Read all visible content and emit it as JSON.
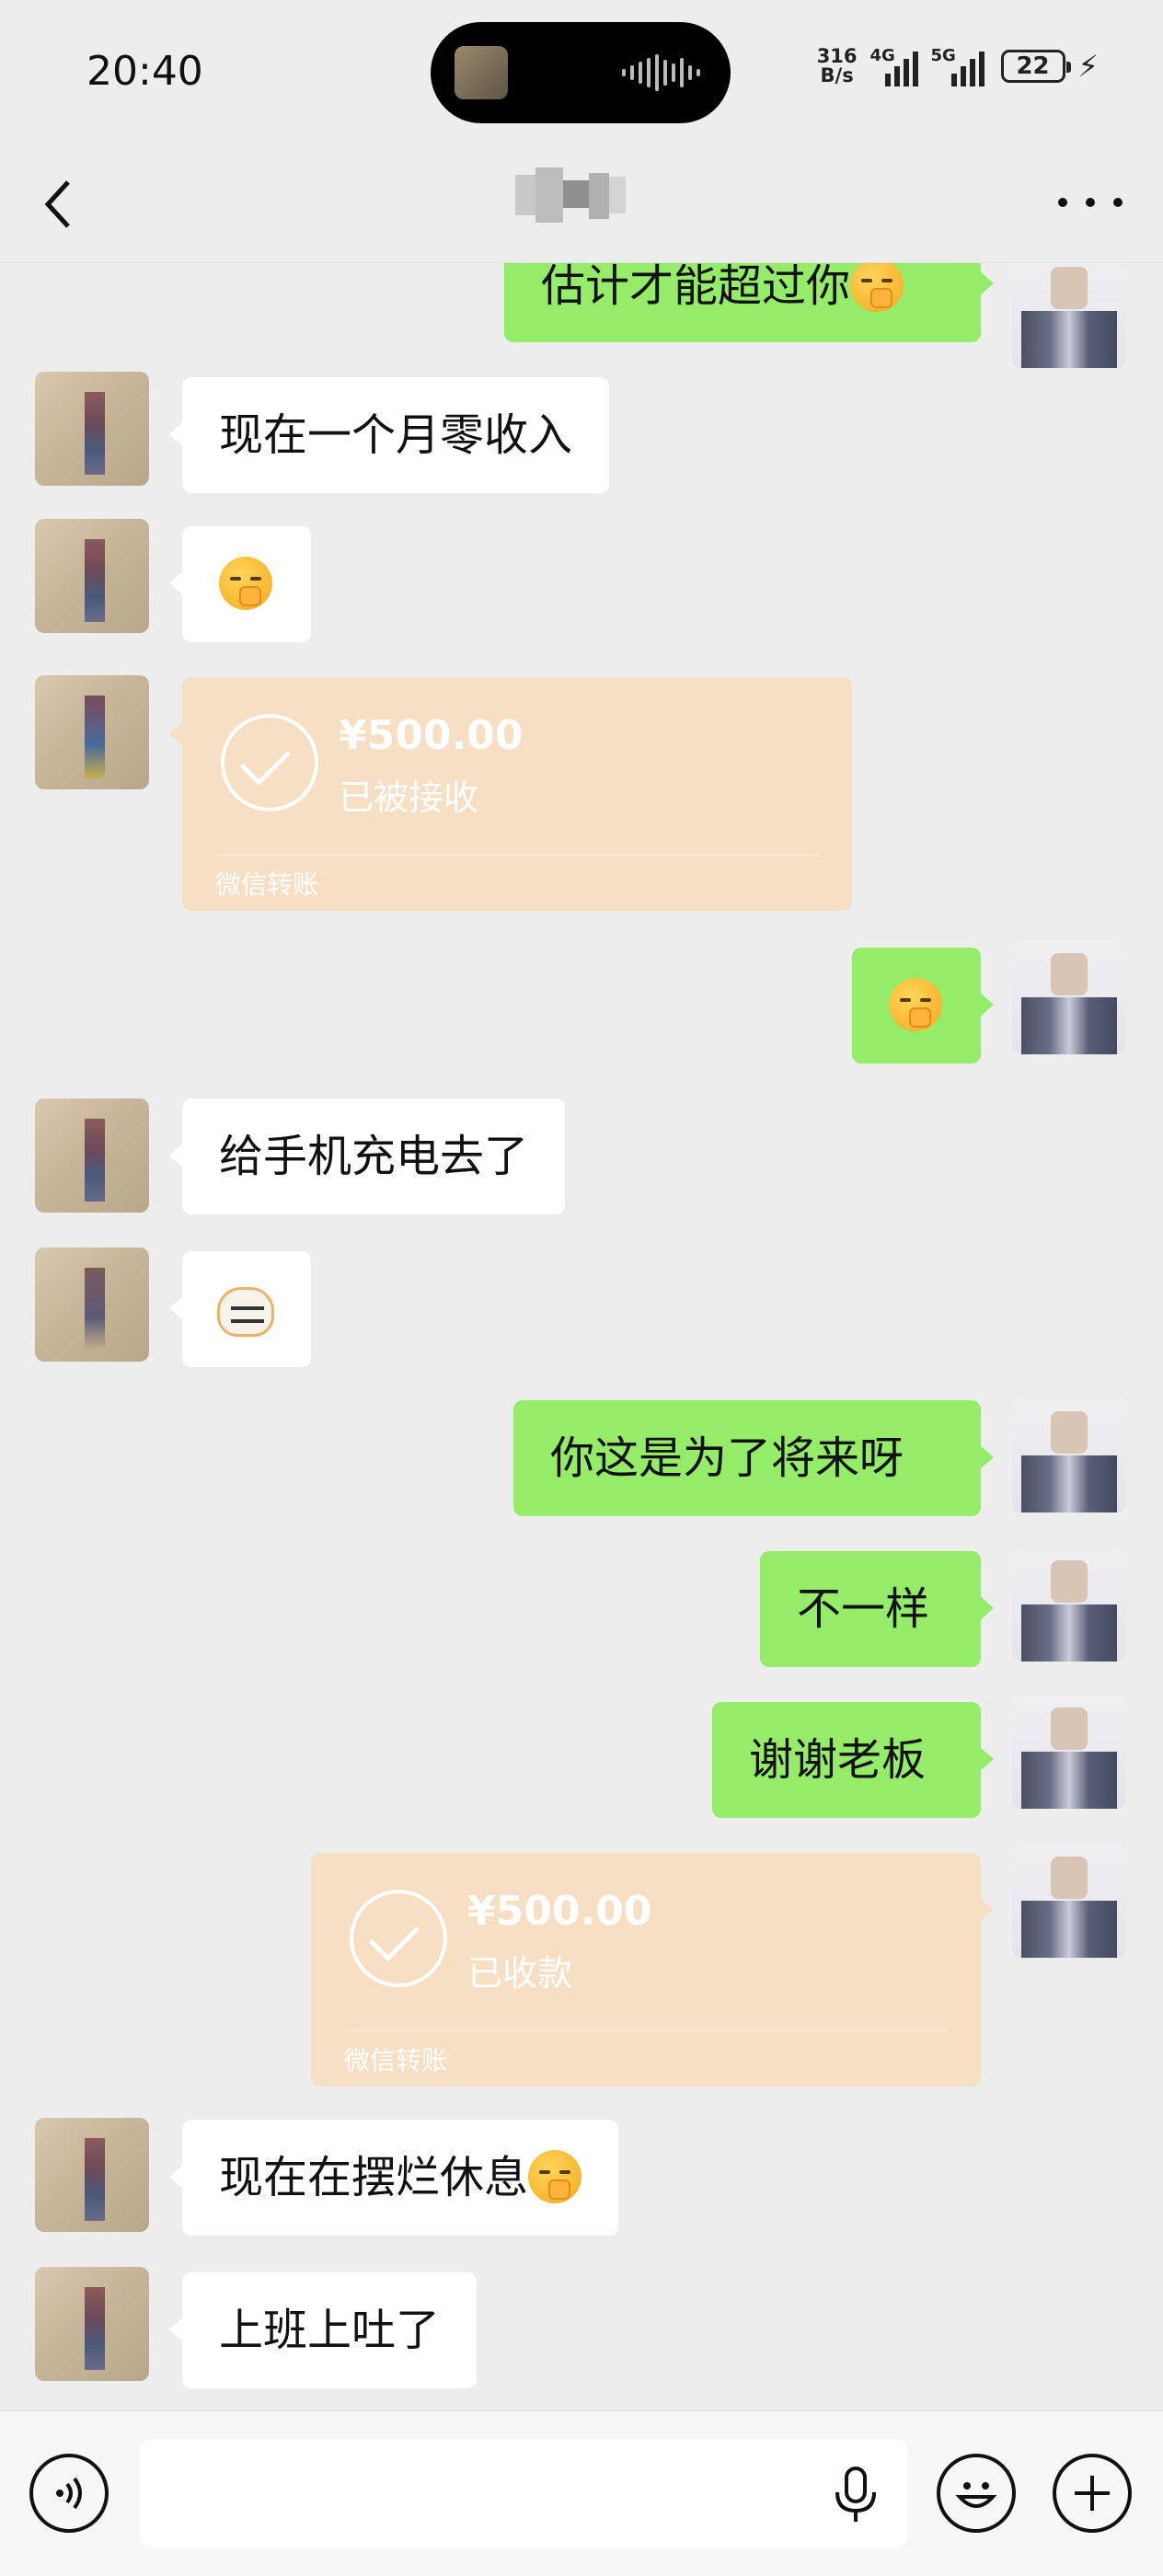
{
  "status_bar": {
    "time": "20:40",
    "net_speed_top": "316",
    "net_speed_bottom": "B/s",
    "sig1_label": "4G",
    "sig2_label": "5G",
    "battery": "22"
  },
  "nav": {
    "back_icon": "chevron-left-icon",
    "more_icon": "more-icon"
  },
  "messages": {
    "m0": {
      "text": "估计才能超过你",
      "side": "right"
    },
    "m1": {
      "text": "现在一个月零收入",
      "side": "left"
    },
    "m3": {
      "amount": "¥500.00",
      "status": "已被接收",
      "source": "微信转账"
    },
    "m5": {
      "text": "给手机充电去了",
      "side": "left"
    },
    "m7": {
      "text": "你这是为了将来呀",
      "side": "right"
    },
    "m8": {
      "text": "不一样",
      "side": "right"
    },
    "m9": {
      "text": "谢谢老板",
      "side": "right"
    },
    "m10": {
      "amount": "¥500.00",
      "status": "已收款",
      "source": "微信转账"
    },
    "m11": {
      "text": "现在在摆烂休息",
      "side": "left"
    },
    "m12": {
      "text": "上班上吐了",
      "side": "left"
    }
  },
  "input_bar": {
    "voice_icon": "voice-mode-icon",
    "mic_icon": "microphone-icon",
    "emoji_icon": "emoji-icon",
    "plus_icon": "plus-icon"
  },
  "colors": {
    "bg": "#ededed",
    "green_bubble": "#95ec69",
    "transfer": "#f7dfc4"
  }
}
